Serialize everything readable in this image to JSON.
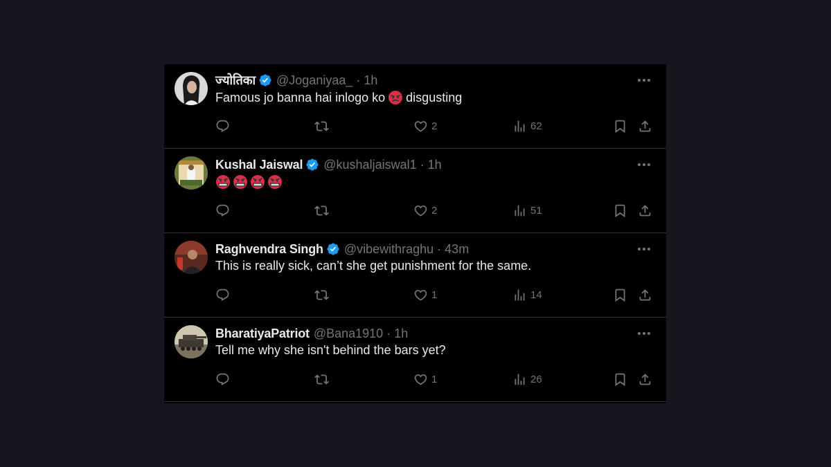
{
  "tweets": [
    {
      "name": "ज्योतिका",
      "handle": "@Joganiyaa_",
      "separator": "·",
      "time": "1h",
      "text_before": "Famous jo banna hai inlogo ko",
      "text_after": "disgusting",
      "emoji": "angry-face",
      "likes": "2",
      "views": "62"
    },
    {
      "name": "Kushal Jaiswal",
      "handle": "@kushaljaiswal1",
      "separator": "·",
      "time": "1h",
      "emoji": "cursing-face",
      "emoji_count": 4,
      "likes": "2",
      "views": "51"
    },
    {
      "name": "Raghvendra Singh",
      "handle": "@vibewithraghu",
      "separator": "·",
      "time": "43m",
      "text": "This is really sick, can’t she get punishment for the same.",
      "likes": "1",
      "views": "14"
    },
    {
      "name": "BharatiyaPatriot",
      "handle": "@Bana1910",
      "separator": "·",
      "time": "1h",
      "text": "Tell me why she isn't behind the bars yet?",
      "likes": "1",
      "views": "26"
    }
  ],
  "icons": {
    "reply": "reply-icon",
    "retweet": "retweet-icon",
    "like": "heart-icon",
    "views": "views-icon",
    "bookmark": "bookmark-icon",
    "share": "share-icon",
    "more": "more-icon",
    "verified": "verified-badge-icon"
  },
  "colors": {
    "background": "#17151d",
    "panel": "#000000",
    "text": "#e7e9ea",
    "muted": "#71767b",
    "verified": "#1d9bf0",
    "divider": "#2f3336"
  }
}
